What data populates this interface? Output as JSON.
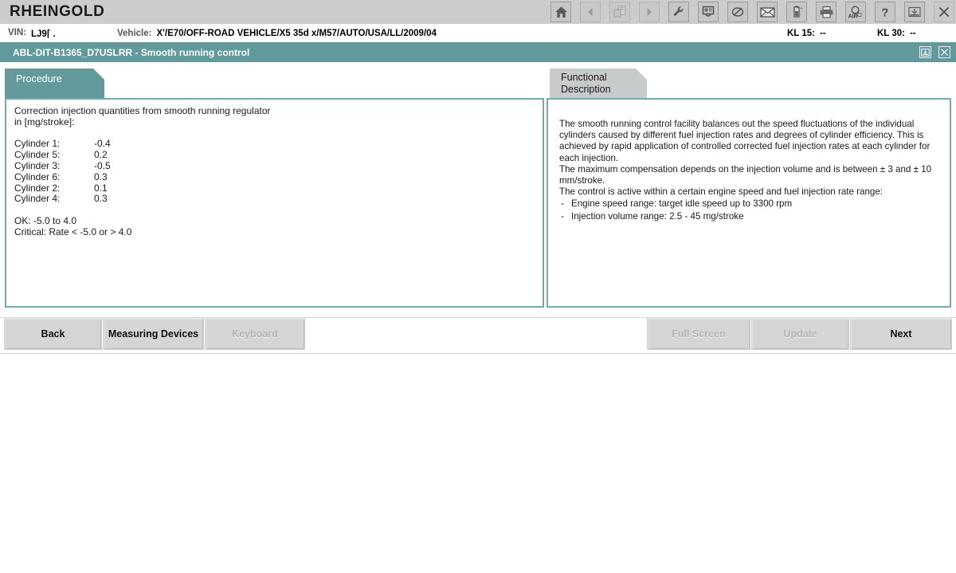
{
  "app": {
    "brand": "RHEINGOLD"
  },
  "toolbar": {
    "icons": [
      {
        "name": "home-icon",
        "label": "Home"
      },
      {
        "name": "back-arrow-icon",
        "label": "Back"
      },
      {
        "name": "documents-icon",
        "label": "Documents"
      },
      {
        "name": "forward-arrow-icon",
        "label": "Forward"
      },
      {
        "name": "wrench-icon",
        "label": "Service"
      },
      {
        "name": "diagnostics-icon",
        "label": "Diagnostics"
      },
      {
        "name": "connector-icon",
        "label": "Connection"
      },
      {
        "name": "mail-icon",
        "label": "Messages"
      },
      {
        "name": "battery-icon",
        "label": "Battery"
      },
      {
        "name": "printer-icon",
        "label": "Print"
      },
      {
        "name": "airbag-search-icon",
        "label": "AIR"
      },
      {
        "name": "help-icon",
        "label": "?"
      },
      {
        "name": "minimize-window-icon",
        "label": "Minimize"
      },
      {
        "name": "close-window-icon",
        "label": "Close"
      }
    ]
  },
  "vehicle_bar": {
    "vin_label": "VIN:",
    "vin_value": "LJ9⌈ .",
    "vehicle_label": "Vehicle:",
    "vehicle_value": "X'/E70/OFF-ROAD VEHICLE/X5 35d x/M57/AUTO/USA/LL/2009/04",
    "kl15_label": "KL 15:",
    "kl15_value": "--",
    "kl30_label": "KL 30:",
    "kl30_value": "--"
  },
  "titlebar": {
    "title": "ABL-DIT-B1365_D7USLRR  -  Smooth running control",
    "buttons": [
      {
        "name": "restore-icon",
        "label": "Restore"
      },
      {
        "name": "close-icon",
        "label": "Close"
      }
    ]
  },
  "tabs": [
    {
      "label": "Procedure",
      "active": true
    },
    {
      "label": "Functional\nDescription",
      "active": false
    }
  ],
  "tab_labels": {
    "procedure": "Procedure",
    "functional_line1": "Functional",
    "functional_line2": "Description"
  },
  "procedure_panel": {
    "heading_line1": "Correction injection quantities from smooth running regulator",
    "heading_line2": "in [mg/stroke]:",
    "cylinders": [
      {
        "name": "Cylinder 1:",
        "value": "-0.4"
      },
      {
        "name": "Cylinder 5:",
        "value": "0.2"
      },
      {
        "name": "Cylinder 3:",
        "value": "-0.5"
      },
      {
        "name": "Cylinder 6:",
        "value": "0.3"
      },
      {
        "name": "Cylinder 2:",
        "value": "0.1"
      },
      {
        "name": "Cylinder 4:",
        "value": "0.3"
      }
    ],
    "ok_line": "OK: -5.0 to 4.0",
    "critical_line": "Critical: Rate < -5.0 or > 4.0"
  },
  "functional_panel": {
    "paragraph1": "The smooth running control facility balances out the speed fluctuations of the individual cylinders caused by different fuel injection rates and degrees of cylinder efficiency. This is achieved by rapid application of controlled corrected fuel injection rates at each cylinder for each injection.",
    "paragraph2": "The maximum compensation depends on the injection volume and is between ± 3 and ± 10 mm/stroke.",
    "paragraph3": "The control is active within a certain engine speed and fuel injection rate range:",
    "bullet_marker": "-",
    "bullet1": "Engine speed range: target idle speed up to 3300 rpm",
    "bullet2": "Injection volume range: 2.5 - 45 mg/stroke"
  },
  "footer_buttons": {
    "back": "Back",
    "measuring_devices": "Measuring Devices",
    "keyboard": "Keyboard",
    "full_screen": "Full Screen",
    "update": "Update",
    "next": "Next"
  },
  "colors": {
    "teal": "#629a9c",
    "topbar_gray": "#cccccc",
    "tab_inactive": "#c8cbcb",
    "button_face": "#d5d5d5",
    "disabled_text": "#b4b4b4",
    "panel_border": "#7aa8aa"
  }
}
